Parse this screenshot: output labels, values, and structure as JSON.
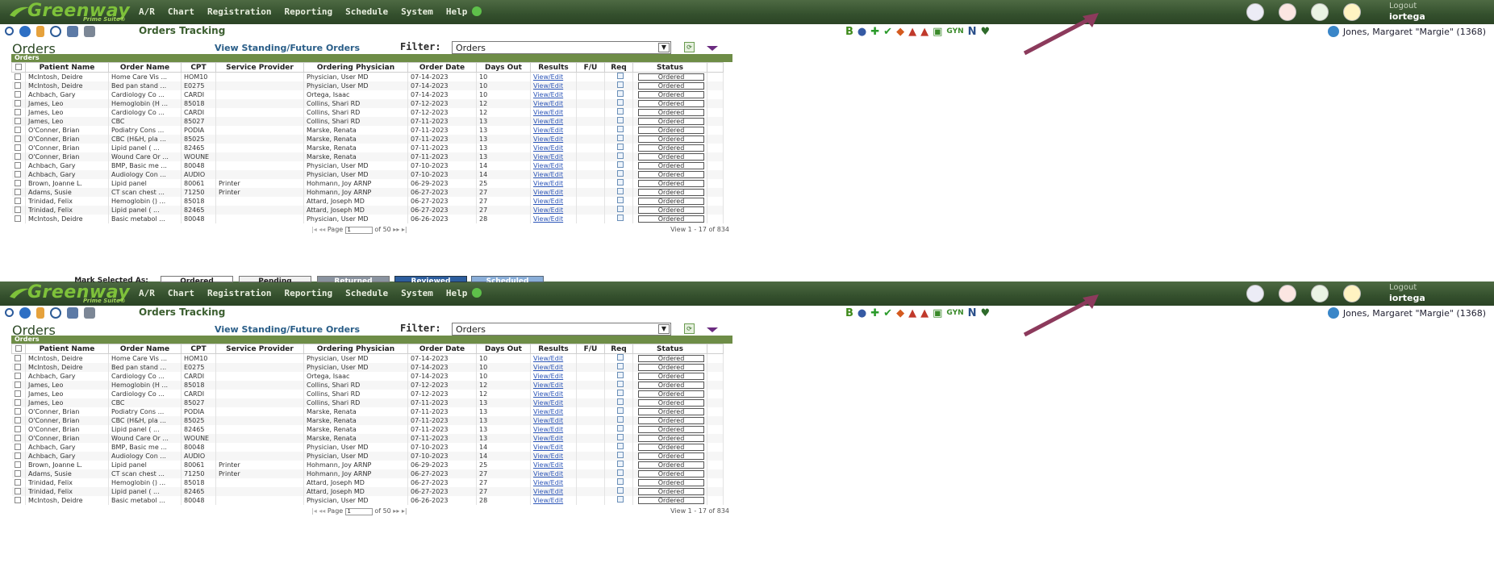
{
  "brand": {
    "name": "Greenway",
    "subtitle": "Prime Suite®"
  },
  "menu": [
    "A/R",
    "Chart",
    "Registration",
    "Reporting",
    "Schedule",
    "System",
    "Help"
  ],
  "top_icons": [
    "notes-icon",
    "message-icon",
    "mail-icon",
    "star-icon"
  ],
  "logout": {
    "label": "Logout",
    "user": "iortega"
  },
  "toolbar": {
    "icons": [
      "search-icon",
      "info-icon",
      "filter-icon",
      "clock-icon",
      "folder-icon",
      "person-icon"
    ],
    "page_title": "Orders Tracking",
    "center_icons": [
      "B",
      "eye-icon",
      "plus-icon",
      "check-icon",
      "pin-icon",
      "alert-icon",
      "nurse-icon",
      "calendar-icon",
      "GYN",
      "N",
      "heart-icon"
    ]
  },
  "patient": "Jones, Margaret \"Margie\" (1368)",
  "orders": {
    "title": "Orders",
    "standing_link": "View Standing/Future Orders",
    "filter_label": "Filter:",
    "filter_value": "Orders",
    "grid_caption": "Orders",
    "columns": [
      "Patient Name",
      "Order Name",
      "CPT",
      "Service Provider",
      "Ordering Physician",
      "Order Date",
      "Days Out",
      "Results",
      "F/U",
      "Req",
      "Status"
    ],
    "rows": [
      [
        "McIntosh, Deidre",
        "Home Care Vis ...",
        "HOM10",
        "",
        "Physician, User MD",
        "07-14-2023",
        "10",
        "View/Edit",
        "",
        "",
        "Ordered"
      ],
      [
        "McIntosh, Deidre",
        "Bed pan stand ...",
        "E0275",
        "",
        "Physician, User MD",
        "07-14-2023",
        "10",
        "View/Edit",
        "",
        "",
        "Ordered"
      ],
      [
        "Achbach, Gary",
        "Cardiology Co ...",
        "CARDI",
        "",
        "Ortega, Isaac",
        "07-14-2023",
        "10",
        "View/Edit",
        "",
        "",
        "Ordered"
      ],
      [
        "James, Leo",
        "Hemoglobin (H ...",
        "85018",
        "",
        "Collins, Shari RD",
        "07-12-2023",
        "12",
        "View/Edit",
        "",
        "",
        "Ordered"
      ],
      [
        "James, Leo",
        "Cardiology Co ...",
        "CARDI",
        "",
        "Collins, Shari RD",
        "07-12-2023",
        "12",
        "View/Edit",
        "",
        "",
        "Ordered"
      ],
      [
        "James, Leo",
        "CBC",
        "85027",
        "",
        "Collins, Shari RD",
        "07-11-2023",
        "13",
        "View/Edit",
        "",
        "",
        "Ordered"
      ],
      [
        "O'Conner, Brian",
        "Podiatry Cons ...",
        "PODIA",
        "",
        "Marske, Renata",
        "07-11-2023",
        "13",
        "View/Edit",
        "",
        "",
        "Ordered"
      ],
      [
        "O'Conner, Brian",
        "CBC (H&H, pla ...",
        "85025",
        "",
        "Marske, Renata",
        "07-11-2023",
        "13",
        "View/Edit",
        "",
        "",
        "Ordered"
      ],
      [
        "O'Conner, Brian",
        "Lipid panel ( ...",
        "82465",
        "",
        "Marske, Renata",
        "07-11-2023",
        "13",
        "View/Edit",
        "",
        "",
        "Ordered"
      ],
      [
        "O'Conner, Brian",
        "Wound Care Or ...",
        "WOUNE",
        "",
        "Marske, Renata",
        "07-11-2023",
        "13",
        "View/Edit",
        "",
        "",
        "Ordered"
      ],
      [
        "Achbach, Gary",
        "BMP, Basic me ...",
        "80048",
        "",
        "Physician, User MD",
        "07-10-2023",
        "14",
        "View/Edit",
        "",
        "",
        "Ordered"
      ],
      [
        "Achbach, Gary",
        "Audiology Con ...",
        "AUDIO",
        "",
        "Physician, User MD",
        "07-10-2023",
        "14",
        "View/Edit",
        "",
        "",
        "Ordered"
      ],
      [
        "Brown, Joanne L.",
        "Lipid panel",
        "80061",
        "Printer",
        "Hohmann, Joy ARNP",
        "06-29-2023",
        "25",
        "View/Edit",
        "",
        "",
        "Ordered"
      ],
      [
        "Adams, Susie",
        "CT scan chest ...",
        "71250",
        "Printer",
        "Hohmann, Joy ARNP",
        "06-27-2023",
        "27",
        "View/Edit",
        "",
        "",
        "Ordered"
      ],
      [
        "Trinidad, Felix",
        "Hemoglobin () ...",
        "85018",
        "",
        "Attard, Joseph MD",
        "06-27-2023",
        "27",
        "View/Edit",
        "",
        "",
        "Ordered"
      ],
      [
        "Trinidad, Felix",
        "Lipid panel ( ...",
        "82465",
        "",
        "Attard, Joseph MD",
        "06-27-2023",
        "27",
        "View/Edit",
        "",
        "",
        "Ordered"
      ],
      [
        "McIntosh, Deidre",
        "Basic metabol ...",
        "80048",
        "",
        "Physician, User MD",
        "06-26-2023",
        "28",
        "View/Edit",
        "",
        "",
        "Ordered"
      ]
    ],
    "pager": {
      "page_label": "Page",
      "page": "1",
      "of_label": "of 50",
      "view_label": "View 1 - 17 of 834"
    }
  },
  "mark_bar": {
    "label": "Mark Selected As:",
    "buttons": [
      "Ordered",
      "Pending",
      "Returned",
      "Reviewed",
      "Scheduled"
    ]
  },
  "colors": {
    "header_green": "#34502d",
    "grid_header": "#6e8d47",
    "arrow": "#8c3a5c",
    "link_blue": "#2d56b8"
  }
}
